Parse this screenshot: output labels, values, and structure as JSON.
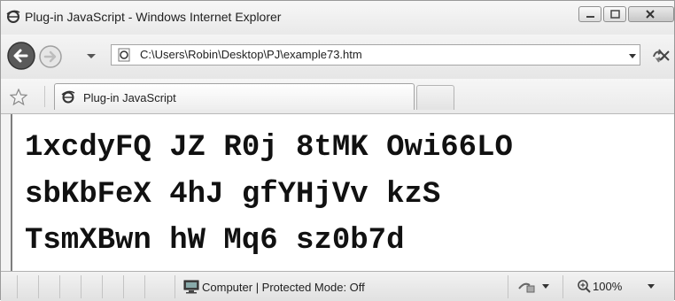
{
  "window": {
    "title": "Plug-in JavaScript - Windows Internet Explorer",
    "controls": [
      "minimize",
      "maximize",
      "close"
    ]
  },
  "address": {
    "url": "C:\\Users\\Robin\\Desktop\\PJ\\example73.htm"
  },
  "tabs": [
    {
      "label": "Plug-in JavaScript",
      "active": true
    }
  ],
  "content": {
    "lines": [
      "1xcdyFQ JZ R0j 8tMK Owi66LO",
      "sbKbFeX 4hJ gfYHjVv kzS",
      "TsmXBwn hW Mq6 sz0b7d"
    ]
  },
  "statusbar": {
    "status": "Computer | Protected Mode: Off",
    "zoom": "100%"
  },
  "icons": {
    "ie": "ie-logo-icon",
    "back": "back-arrow-icon",
    "forward": "forward-arrow-icon",
    "favorites": "star-icon",
    "computer": "computer-icon",
    "zone": "security-zone-icon",
    "zoom": "magnifier-icon"
  }
}
